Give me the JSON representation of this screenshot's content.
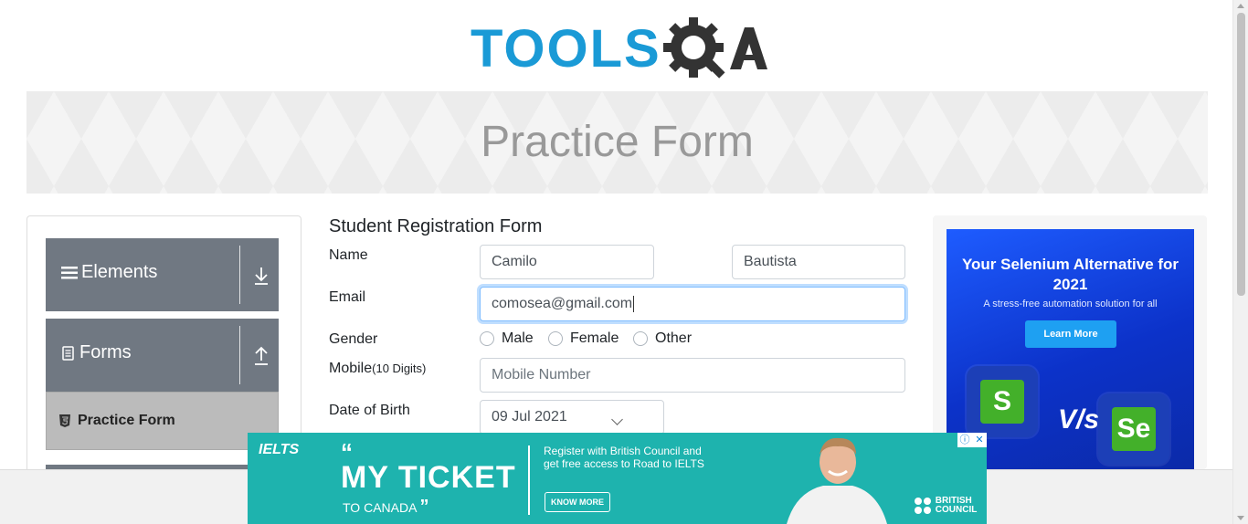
{
  "logo": {
    "text": "TOOLS",
    "text2": "QA"
  },
  "banner": {
    "title": "Practice Form"
  },
  "sidebar": {
    "groups": [
      {
        "label": "Elements",
        "icon": "menu-icon",
        "toggle": "download-arrow-icon"
      },
      {
        "label": "Forms",
        "icon": "document-icon",
        "toggle": "upload-arrow-icon"
      }
    ],
    "active_item": {
      "label": "Practice Form",
      "icon": "html5-icon"
    }
  },
  "form": {
    "title": "Student Registration Form",
    "name_label": "Name",
    "first_name": "Camilo",
    "last_name": "Bautista",
    "email_label": "Email",
    "email_value": "comosea@gmail.com",
    "gender_label": "Gender",
    "gender_options": [
      "Male",
      "Female",
      "Other"
    ],
    "mobile_label": "Mobile",
    "mobile_hint": "(10 Digits)",
    "mobile_placeholder": "Mobile Number",
    "dob_label": "Date of Birth",
    "dob_value": "09 Jul 2021"
  },
  "ad_right": {
    "title": "Your Selenium Alternative for 2021",
    "subtitle": "A stress-free automation solution for all",
    "button": "Learn More",
    "vs": "V/s",
    "tile_left": "S",
    "tile_right": "Se",
    "colors": {
      "bg": "#0c32c9",
      "button": "#1ea0f2",
      "tile": "#43b02a"
    }
  },
  "ad_bottom": {
    "brand": "IELTS",
    "headline": "MY TICKET",
    "sub": "TO CANADA",
    "message": "Register with British Council and get free access to Road to IELTS",
    "button": "KNOW MORE",
    "sponsor_line1": "BRITISH",
    "sponsor_line2": "COUNCIL",
    "close_icons": [
      "info-icon",
      "close-icon"
    ],
    "colors": {
      "bg": "#1eb3ae"
    }
  }
}
